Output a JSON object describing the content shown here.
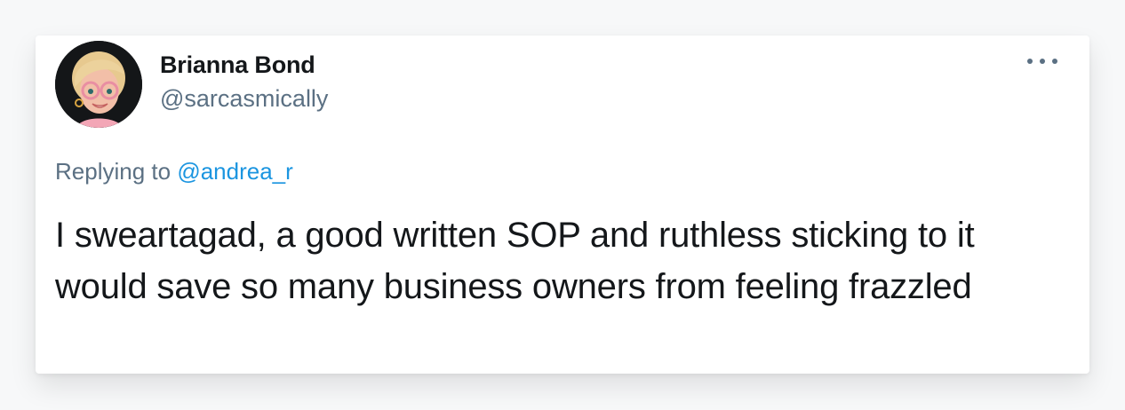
{
  "tweet": {
    "author_name": "Brianna Bond",
    "author_handle": "@sarcasmically",
    "reply_prefix": "Replying to",
    "reply_to": "@andrea_r",
    "text": "I sweartagad, a good written SOP and ruthless sticking to it would save so many business owners from feeling frazzled",
    "more_icon": "more-horizontal-icon",
    "avatar_icon": "memoji-avatar"
  },
  "colors": {
    "text_primary": "#14171a",
    "text_secondary": "#5b7083",
    "link": "#1b95e0",
    "card_background": "#ffffff"
  }
}
